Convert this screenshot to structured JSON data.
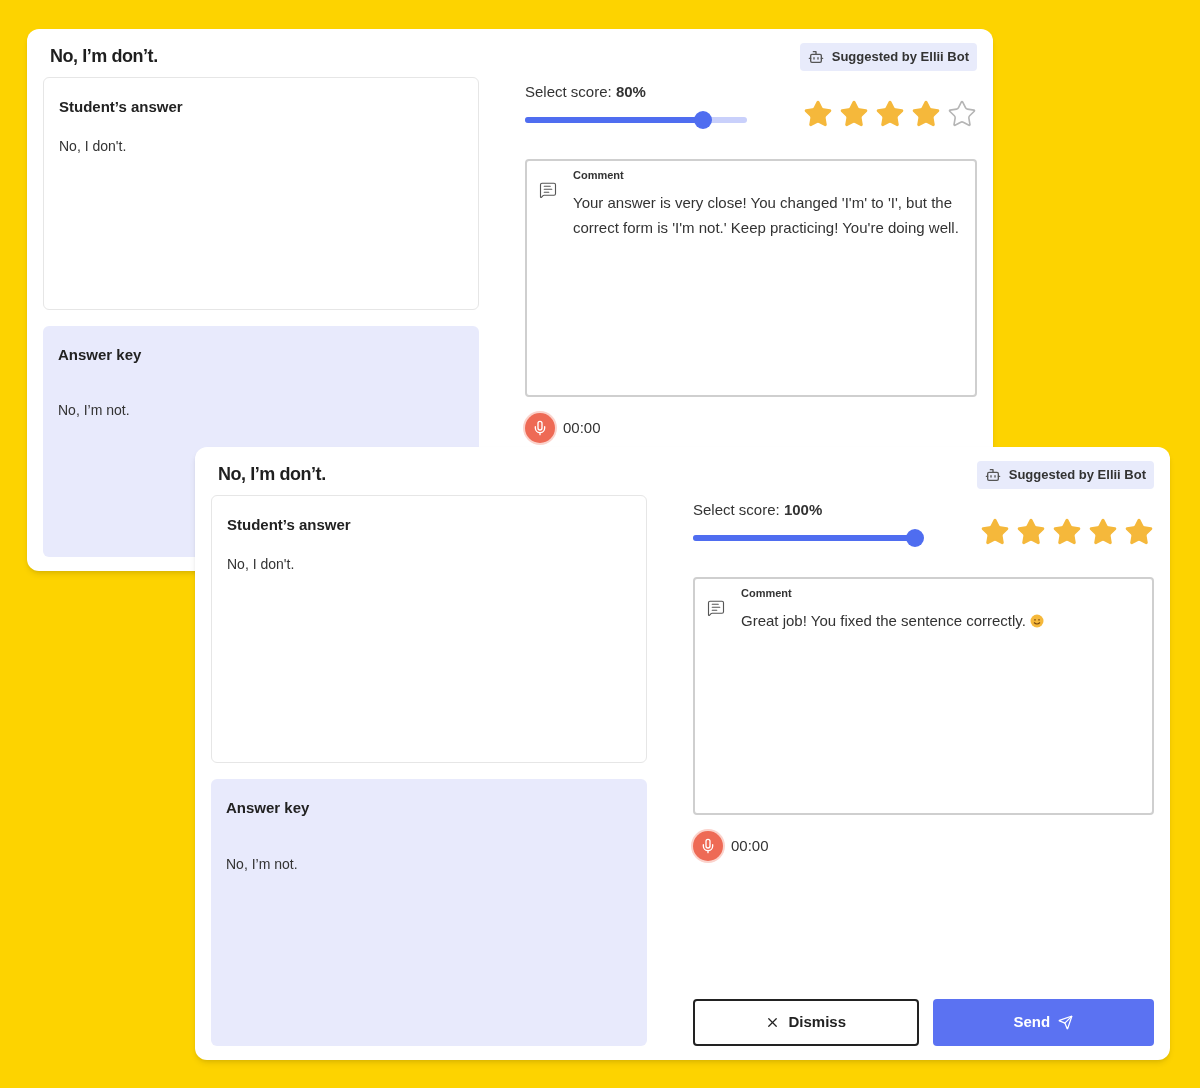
{
  "cards": [
    {
      "title": "No, I’m don’t.",
      "badge": "Suggested by Ellii Bot",
      "student_answer": {
        "label": "Student’s answer",
        "text": "No, I don't."
      },
      "answer_key": {
        "label": "Answer key",
        "text": "No, I’m not."
      },
      "score": {
        "label": "Select score: **80%**",
        "level": 0.8
      },
      "stars": 4,
      "comment": {
        "label": "Comment",
        "text": "Your answer is very close! You changed 'I'm' to 'I', but the correct form is 'I'm not.' Keep practicing! You're doing well."
      },
      "recorder": {
        "time": "00:00"
      }
    },
    {
      "title": "No, I’m don’t.",
      "badge": "Suggested by Ellii Bot",
      "student_answer": {
        "label": "Student’s answer",
        "text": "No, I don't."
      },
      "answer_key": {
        "label": "Answer key",
        "text": "No, I’m not."
      },
      "score": {
        "label": "Select score: **100%**",
        "level": 1
      },
      "stars": 5,
      "comment": {
        "label": "Comment",
        "text": "Great job! You fixed the sentence correctly.",
        "smiley": true
      },
      "recorder": {
        "time": "00:00"
      },
      "buttons": [
        {
          "kind": "dismiss",
          "label": "Dismiss"
        },
        {
          "kind": "send",
          "label": "Send"
        }
      ]
    }
  ]
}
